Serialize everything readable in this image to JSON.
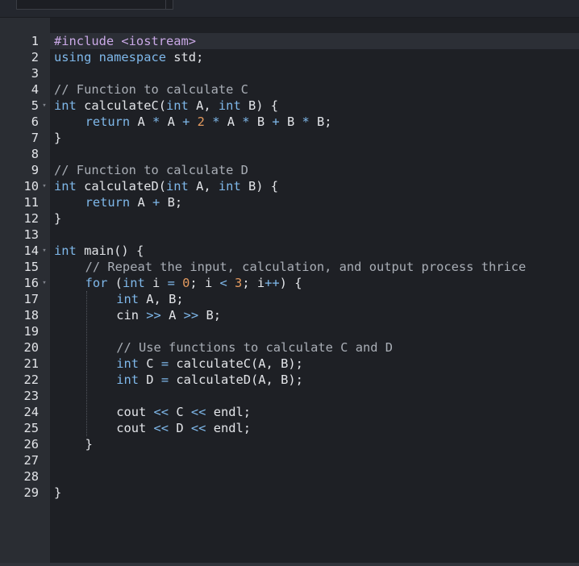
{
  "editor": {
    "language": "C++",
    "active_line": 1,
    "colors": {
      "background": "#1e2025",
      "gutter": "#2a2d33",
      "keyword": "#7fb8ea",
      "comment": "#a9aeb6",
      "number": "#e39a5f",
      "text": "#e2e4e8"
    },
    "lines": [
      {
        "number": "1",
        "fold": false,
        "indent": 0,
        "tokens": [
          {
            "t": "#include <iostream>",
            "c": "preproc"
          }
        ]
      },
      {
        "number": "2",
        "fold": false,
        "indent": 0,
        "tokens": [
          {
            "t": "using namespace ",
            "c": "keyword"
          },
          {
            "t": "std;",
            "c": "plain"
          }
        ]
      },
      {
        "number": "3",
        "fold": false,
        "indent": 0,
        "tokens": []
      },
      {
        "number": "4",
        "fold": false,
        "indent": 0,
        "tokens": [
          {
            "t": "// Function to calculate C",
            "c": "comment"
          }
        ]
      },
      {
        "number": "5",
        "fold": true,
        "indent": 0,
        "tokens": [
          {
            "t": "int ",
            "c": "keyword"
          },
          {
            "t": "calculateC(",
            "c": "plain"
          },
          {
            "t": "int ",
            "c": "keyword"
          },
          {
            "t": "A, ",
            "c": "plain"
          },
          {
            "t": "int ",
            "c": "keyword"
          },
          {
            "t": "B) {",
            "c": "plain"
          }
        ]
      },
      {
        "number": "6",
        "fold": false,
        "indent": 1,
        "tokens": [
          {
            "t": "return ",
            "c": "keyword"
          },
          {
            "t": "A ",
            "c": "plain"
          },
          {
            "t": "* ",
            "c": "operator"
          },
          {
            "t": "A ",
            "c": "plain"
          },
          {
            "t": "+ ",
            "c": "operator"
          },
          {
            "t": "2 ",
            "c": "number"
          },
          {
            "t": "* ",
            "c": "operator"
          },
          {
            "t": "A ",
            "c": "plain"
          },
          {
            "t": "* ",
            "c": "operator"
          },
          {
            "t": "B ",
            "c": "plain"
          },
          {
            "t": "+ ",
            "c": "operator"
          },
          {
            "t": "B ",
            "c": "plain"
          },
          {
            "t": "* ",
            "c": "operator"
          },
          {
            "t": "B;",
            "c": "plain"
          }
        ]
      },
      {
        "number": "7",
        "fold": false,
        "indent": 0,
        "tokens": [
          {
            "t": "}",
            "c": "plain"
          }
        ]
      },
      {
        "number": "8",
        "fold": false,
        "indent": 0,
        "tokens": []
      },
      {
        "number": "9",
        "fold": false,
        "indent": 0,
        "tokens": [
          {
            "t": "// Function to calculate D",
            "c": "comment"
          }
        ]
      },
      {
        "number": "10",
        "fold": true,
        "indent": 0,
        "tokens": [
          {
            "t": "int ",
            "c": "keyword"
          },
          {
            "t": "calculateD(",
            "c": "plain"
          },
          {
            "t": "int ",
            "c": "keyword"
          },
          {
            "t": "A, ",
            "c": "plain"
          },
          {
            "t": "int ",
            "c": "keyword"
          },
          {
            "t": "B) {",
            "c": "plain"
          }
        ]
      },
      {
        "number": "11",
        "fold": false,
        "indent": 1,
        "tokens": [
          {
            "t": "return ",
            "c": "keyword"
          },
          {
            "t": "A ",
            "c": "plain"
          },
          {
            "t": "+ ",
            "c": "operator"
          },
          {
            "t": "B;",
            "c": "plain"
          }
        ]
      },
      {
        "number": "12",
        "fold": false,
        "indent": 0,
        "tokens": [
          {
            "t": "}",
            "c": "plain"
          }
        ]
      },
      {
        "number": "13",
        "fold": false,
        "indent": 0,
        "tokens": []
      },
      {
        "number": "14",
        "fold": true,
        "indent": 0,
        "tokens": [
          {
            "t": "int ",
            "c": "keyword"
          },
          {
            "t": "main() {",
            "c": "plain"
          }
        ]
      },
      {
        "number": "15",
        "fold": false,
        "indent": 1,
        "tokens": [
          {
            "t": "// Repeat the input, calculation, and output process thrice",
            "c": "comment"
          }
        ]
      },
      {
        "number": "16",
        "fold": true,
        "indent": 1,
        "tokens": [
          {
            "t": "for ",
            "c": "keyword"
          },
          {
            "t": "(",
            "c": "plain"
          },
          {
            "t": "int ",
            "c": "keyword"
          },
          {
            "t": "i ",
            "c": "plain"
          },
          {
            "t": "= ",
            "c": "operator"
          },
          {
            "t": "0",
            "c": "number"
          },
          {
            "t": "; i ",
            "c": "plain"
          },
          {
            "t": "< ",
            "c": "operator"
          },
          {
            "t": "3",
            "c": "number"
          },
          {
            "t": "; i",
            "c": "plain"
          },
          {
            "t": "++",
            "c": "operator"
          },
          {
            "t": ") {",
            "c": "plain"
          }
        ]
      },
      {
        "number": "17",
        "fold": false,
        "indent": 2,
        "tokens": [
          {
            "t": "int ",
            "c": "keyword"
          },
          {
            "t": "A, B;",
            "c": "plain"
          }
        ]
      },
      {
        "number": "18",
        "fold": false,
        "indent": 2,
        "tokens": [
          {
            "t": "cin ",
            "c": "plain"
          },
          {
            "t": ">> ",
            "c": "operator"
          },
          {
            "t": "A ",
            "c": "plain"
          },
          {
            "t": ">> ",
            "c": "operator"
          },
          {
            "t": "B;",
            "c": "plain"
          }
        ]
      },
      {
        "number": "19",
        "fold": false,
        "indent": 2,
        "tokens": []
      },
      {
        "number": "20",
        "fold": false,
        "indent": 2,
        "tokens": [
          {
            "t": "// Use functions to calculate C and D",
            "c": "comment"
          }
        ]
      },
      {
        "number": "21",
        "fold": false,
        "indent": 2,
        "tokens": [
          {
            "t": "int ",
            "c": "keyword"
          },
          {
            "t": "C ",
            "c": "plain"
          },
          {
            "t": "= ",
            "c": "operator"
          },
          {
            "t": "calculateC(A, B);",
            "c": "plain"
          }
        ]
      },
      {
        "number": "22",
        "fold": false,
        "indent": 2,
        "tokens": [
          {
            "t": "int ",
            "c": "keyword"
          },
          {
            "t": "D ",
            "c": "plain"
          },
          {
            "t": "= ",
            "c": "operator"
          },
          {
            "t": "calculateD(A, B);",
            "c": "plain"
          }
        ]
      },
      {
        "number": "23",
        "fold": false,
        "indent": 2,
        "tokens": []
      },
      {
        "number": "24",
        "fold": false,
        "indent": 2,
        "tokens": [
          {
            "t": "cout ",
            "c": "plain"
          },
          {
            "t": "<< ",
            "c": "operator"
          },
          {
            "t": "C ",
            "c": "plain"
          },
          {
            "t": "<< ",
            "c": "operator"
          },
          {
            "t": "endl;",
            "c": "plain"
          }
        ]
      },
      {
        "number": "25",
        "fold": false,
        "indent": 2,
        "tokens": [
          {
            "t": "cout ",
            "c": "plain"
          },
          {
            "t": "<< ",
            "c": "operator"
          },
          {
            "t": "D ",
            "c": "plain"
          },
          {
            "t": "<< ",
            "c": "operator"
          },
          {
            "t": "endl;",
            "c": "plain"
          }
        ]
      },
      {
        "number": "26",
        "fold": false,
        "indent": 1,
        "tokens": [
          {
            "t": "}",
            "c": "plain"
          }
        ]
      },
      {
        "number": "27",
        "fold": false,
        "indent": 1,
        "tokens": []
      },
      {
        "number": "28",
        "fold": false,
        "indent": 1,
        "tokens": []
      },
      {
        "number": "29",
        "fold": false,
        "indent": 0,
        "tokens": [
          {
            "t": "}",
            "c": "plain"
          }
        ]
      }
    ]
  }
}
